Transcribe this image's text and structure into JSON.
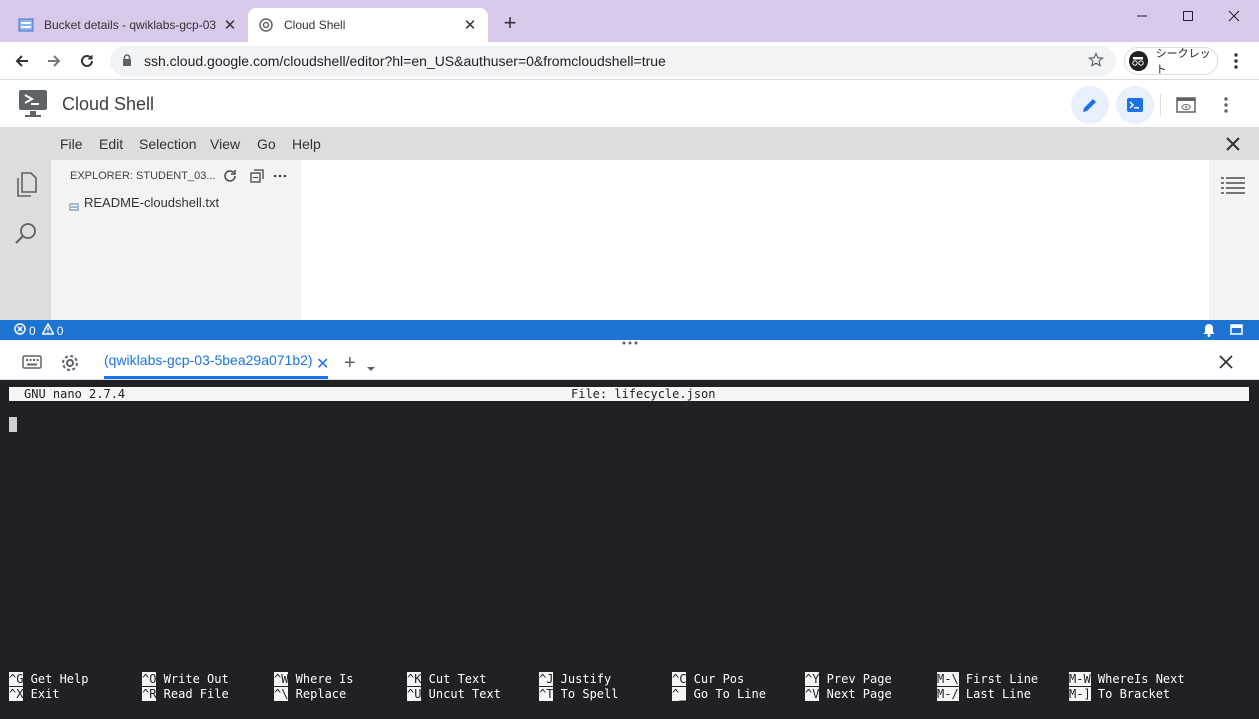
{
  "browser": {
    "tabs": [
      {
        "title": "Bucket details - qwiklabs-gcp-03",
        "active": false
      },
      {
        "title": "Cloud Shell",
        "active": true
      }
    ],
    "url": "ssh.cloud.google.com/cloudshell/editor?hl=en_US&authuser=0&fromcloudshell=true",
    "incognito_label": "シークレット",
    "frame_color": "#d8c8ea"
  },
  "app": {
    "title": "Cloud Shell",
    "accent": "#1a73e8"
  },
  "editor": {
    "menu": [
      "File",
      "Edit",
      "Selection",
      "View",
      "Go",
      "Help"
    ],
    "explorer_title": "EXPLORER: STUDENT_03...",
    "files": [
      "README-cloudshell.txt"
    ],
    "status": {
      "errors": "0",
      "warnings": "0",
      "bar_color": "#1c73d1"
    }
  },
  "terminal": {
    "tab_label": "(qwiklabs-gcp-03-5bea29a071b2)",
    "nano_version": "GNU nano 2.7.4",
    "file_label": "File: lifecycle.json",
    "shortcuts": [
      [
        {
          "key": "^G",
          "label": "Get Help"
        },
        {
          "key": "^X",
          "label": "Exit"
        }
      ],
      [
        {
          "key": "^O",
          "label": "Write Out"
        },
        {
          "key": "^R",
          "label": "Read File"
        }
      ],
      [
        {
          "key": "^W",
          "label": "Where Is"
        },
        {
          "key": "^\\",
          "label": "Replace"
        }
      ],
      [
        {
          "key": "^K",
          "label": "Cut Text"
        },
        {
          "key": "^U",
          "label": "Uncut Text"
        }
      ],
      [
        {
          "key": "^J",
          "label": "Justify"
        },
        {
          "key": "^T",
          "label": "To Spell"
        }
      ],
      [
        {
          "key": "^C",
          "label": "Cur Pos"
        },
        {
          "key": "^_",
          "label": "Go To Line"
        }
      ],
      [
        {
          "key": "^Y",
          "label": "Prev Page"
        },
        {
          "key": "^V",
          "label": "Next Page"
        }
      ],
      [
        {
          "key": "M-\\",
          "label": "First Line"
        },
        {
          "key": "M-/",
          "label": "Last Line"
        }
      ],
      [
        {
          "key": "M-W",
          "label": "WhereIs Next"
        },
        {
          "key": "M-]",
          "label": "To Bracket"
        }
      ]
    ]
  }
}
